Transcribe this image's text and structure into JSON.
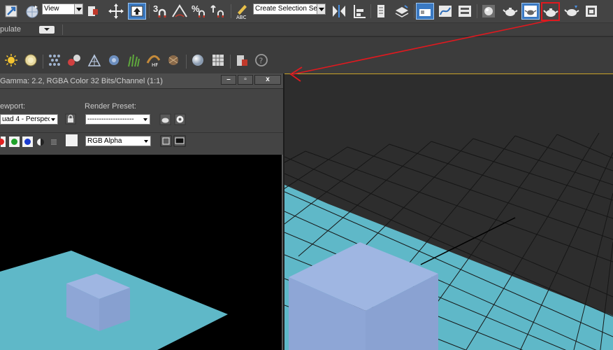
{
  "toolbar": {
    "ref_coord_value": "View",
    "selection_set_value": "Create Selection Se",
    "snap_3_label": "3",
    "snap_angle_label": "%",
    "highlight_color": "#e0191f",
    "active_color": "#3a79c2"
  },
  "ribbon": {
    "label": "pulate"
  },
  "frame_window": {
    "title": "Gamma: 2.2, RGBA Color 32 Bits/Channel (1:1)",
    "viewport_label": "ewport:",
    "viewport_value": "uad 4 - Perspec",
    "render_preset_label": "Render Preset:",
    "render_preset_value": "--------------------",
    "channel_value": "RGB Alpha",
    "minimize": "–",
    "maximize": "▫",
    "close": "x"
  },
  "scene": {
    "plane_color": "#5fb8c8",
    "box_color": "#8ea6d6",
    "grid_color": "#171717",
    "viewport_bg": "#2d2d2d"
  }
}
